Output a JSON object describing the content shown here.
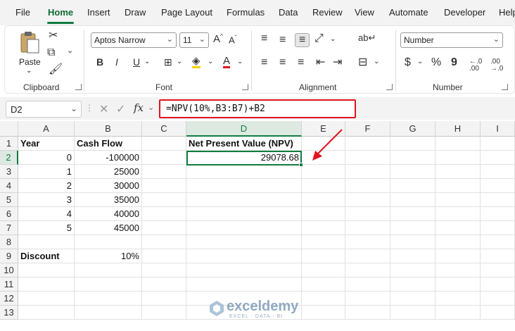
{
  "menu": {
    "tabs": [
      "File",
      "Home",
      "Insert",
      "Draw",
      "Page Layout",
      "Formulas",
      "Data",
      "Review",
      "View",
      "Automate",
      "Developer",
      "Help"
    ],
    "active": "Home"
  },
  "ribbon": {
    "clipboard": {
      "label": "Clipboard",
      "paste_label": "Paste"
    },
    "font": {
      "label": "Font",
      "font_name": "Aptos Narrow",
      "font_size": "11",
      "bold": "B",
      "italic": "I",
      "underline": "U"
    },
    "alignment": {
      "label": "Alignment"
    },
    "number": {
      "label": "Number",
      "format": "Number",
      "currency": "$",
      "percent": "%",
      "comma": "9"
    }
  },
  "formula_bar": {
    "name_box": "D2",
    "fx": "fx",
    "formula": "=NPV(10%,B3:B7)+B2"
  },
  "sheet": {
    "columns": [
      "A",
      "B",
      "C",
      "D",
      "E",
      "F",
      "G",
      "H",
      "I"
    ],
    "rows": [
      "1",
      "2",
      "3",
      "4",
      "5",
      "6",
      "7",
      "8",
      "9",
      "10",
      "11",
      "12",
      "13"
    ],
    "cells": {
      "A1": "Year",
      "B1": "Cash Flow",
      "D1": "Net Present Value (NPV)",
      "A2": "0",
      "B2": "-100000",
      "D2": "29078.68",
      "A3": "1",
      "B3": "25000",
      "A4": "2",
      "B4": "30000",
      "A5": "3",
      "B5": "35000",
      "A6": "4",
      "B6": "40000",
      "A7": "5",
      "B7": "45000",
      "A9": "Discount",
      "B9": "10%"
    },
    "selected_cell": "D2"
  },
  "watermark": {
    "name": "exceldemy",
    "tagline": "EXCEL · DATA · BI"
  },
  "colors": {
    "accent": "#107c41",
    "highlight_box": "#e0141e",
    "arrow": "#e0141e"
  }
}
